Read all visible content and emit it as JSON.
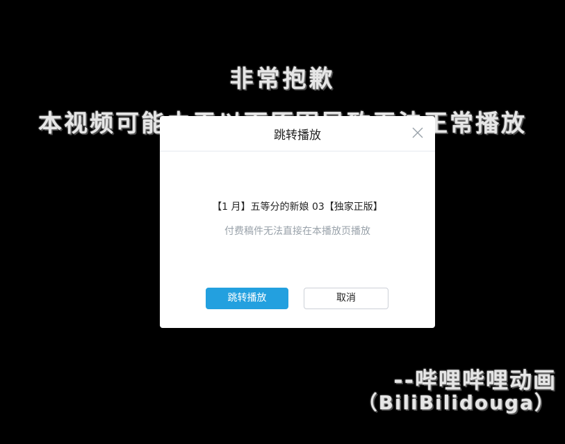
{
  "background": {
    "title": "非常抱歉",
    "message": "本视频可能由于以下原因导致无法正常播放",
    "signature": "--哔哩哔哩动画",
    "signature_sub": "（BiliBilidouga）"
  },
  "dialog": {
    "title": "跳转播放",
    "close_icon": "close-icon",
    "video_title": "【1 月】五等分的新娘 03【独家正版】",
    "notice": "付费稿件无法直接在本播放页播放",
    "confirm_label": "跳转播放",
    "cancel_label": "取消"
  },
  "colors": {
    "overlay": "#000000",
    "primary": "#23a0df",
    "muted_text": "#99a2aa"
  }
}
